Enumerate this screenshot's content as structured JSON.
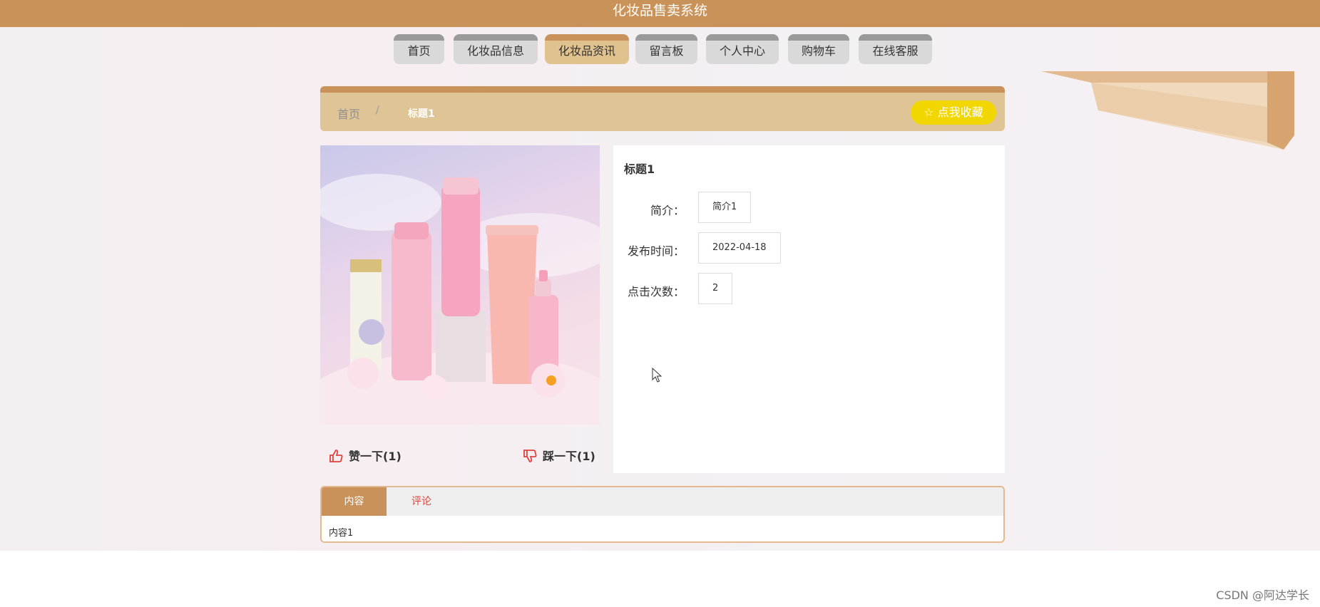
{
  "header": {
    "title": "化妆品售卖系统"
  },
  "nav": {
    "items": [
      "首页",
      "化妆品信息",
      "化妆品资讯",
      "留言板",
      "个人中心",
      "购物车",
      "在线客服"
    ],
    "active_index": 2
  },
  "breadcrumb": {
    "home": "首页",
    "separator": "/",
    "current": "标题1"
  },
  "favorite_button": "☆ 点我收藏",
  "product": {
    "image_icon": "cosmetics-product-photo",
    "like_label": "赞一下(1)",
    "dislike_label": "踩一下(1)"
  },
  "info": {
    "title": "标题1",
    "fields": [
      {
        "label": "简介：",
        "value": "简介1"
      },
      {
        "label": "发布时间：",
        "value": "2022-04-18"
      },
      {
        "label": "点击次数：",
        "value": "2"
      }
    ]
  },
  "tabs": {
    "items": [
      "内容",
      "评论"
    ],
    "active_index": 0,
    "content": "内容1"
  },
  "watermark": "CSDN @阿达学长",
  "colors": {
    "brand": "#c9925a",
    "tan": "#dfc495",
    "fav_yellow": "#f2d600",
    "comment_red": "#e0433b"
  }
}
